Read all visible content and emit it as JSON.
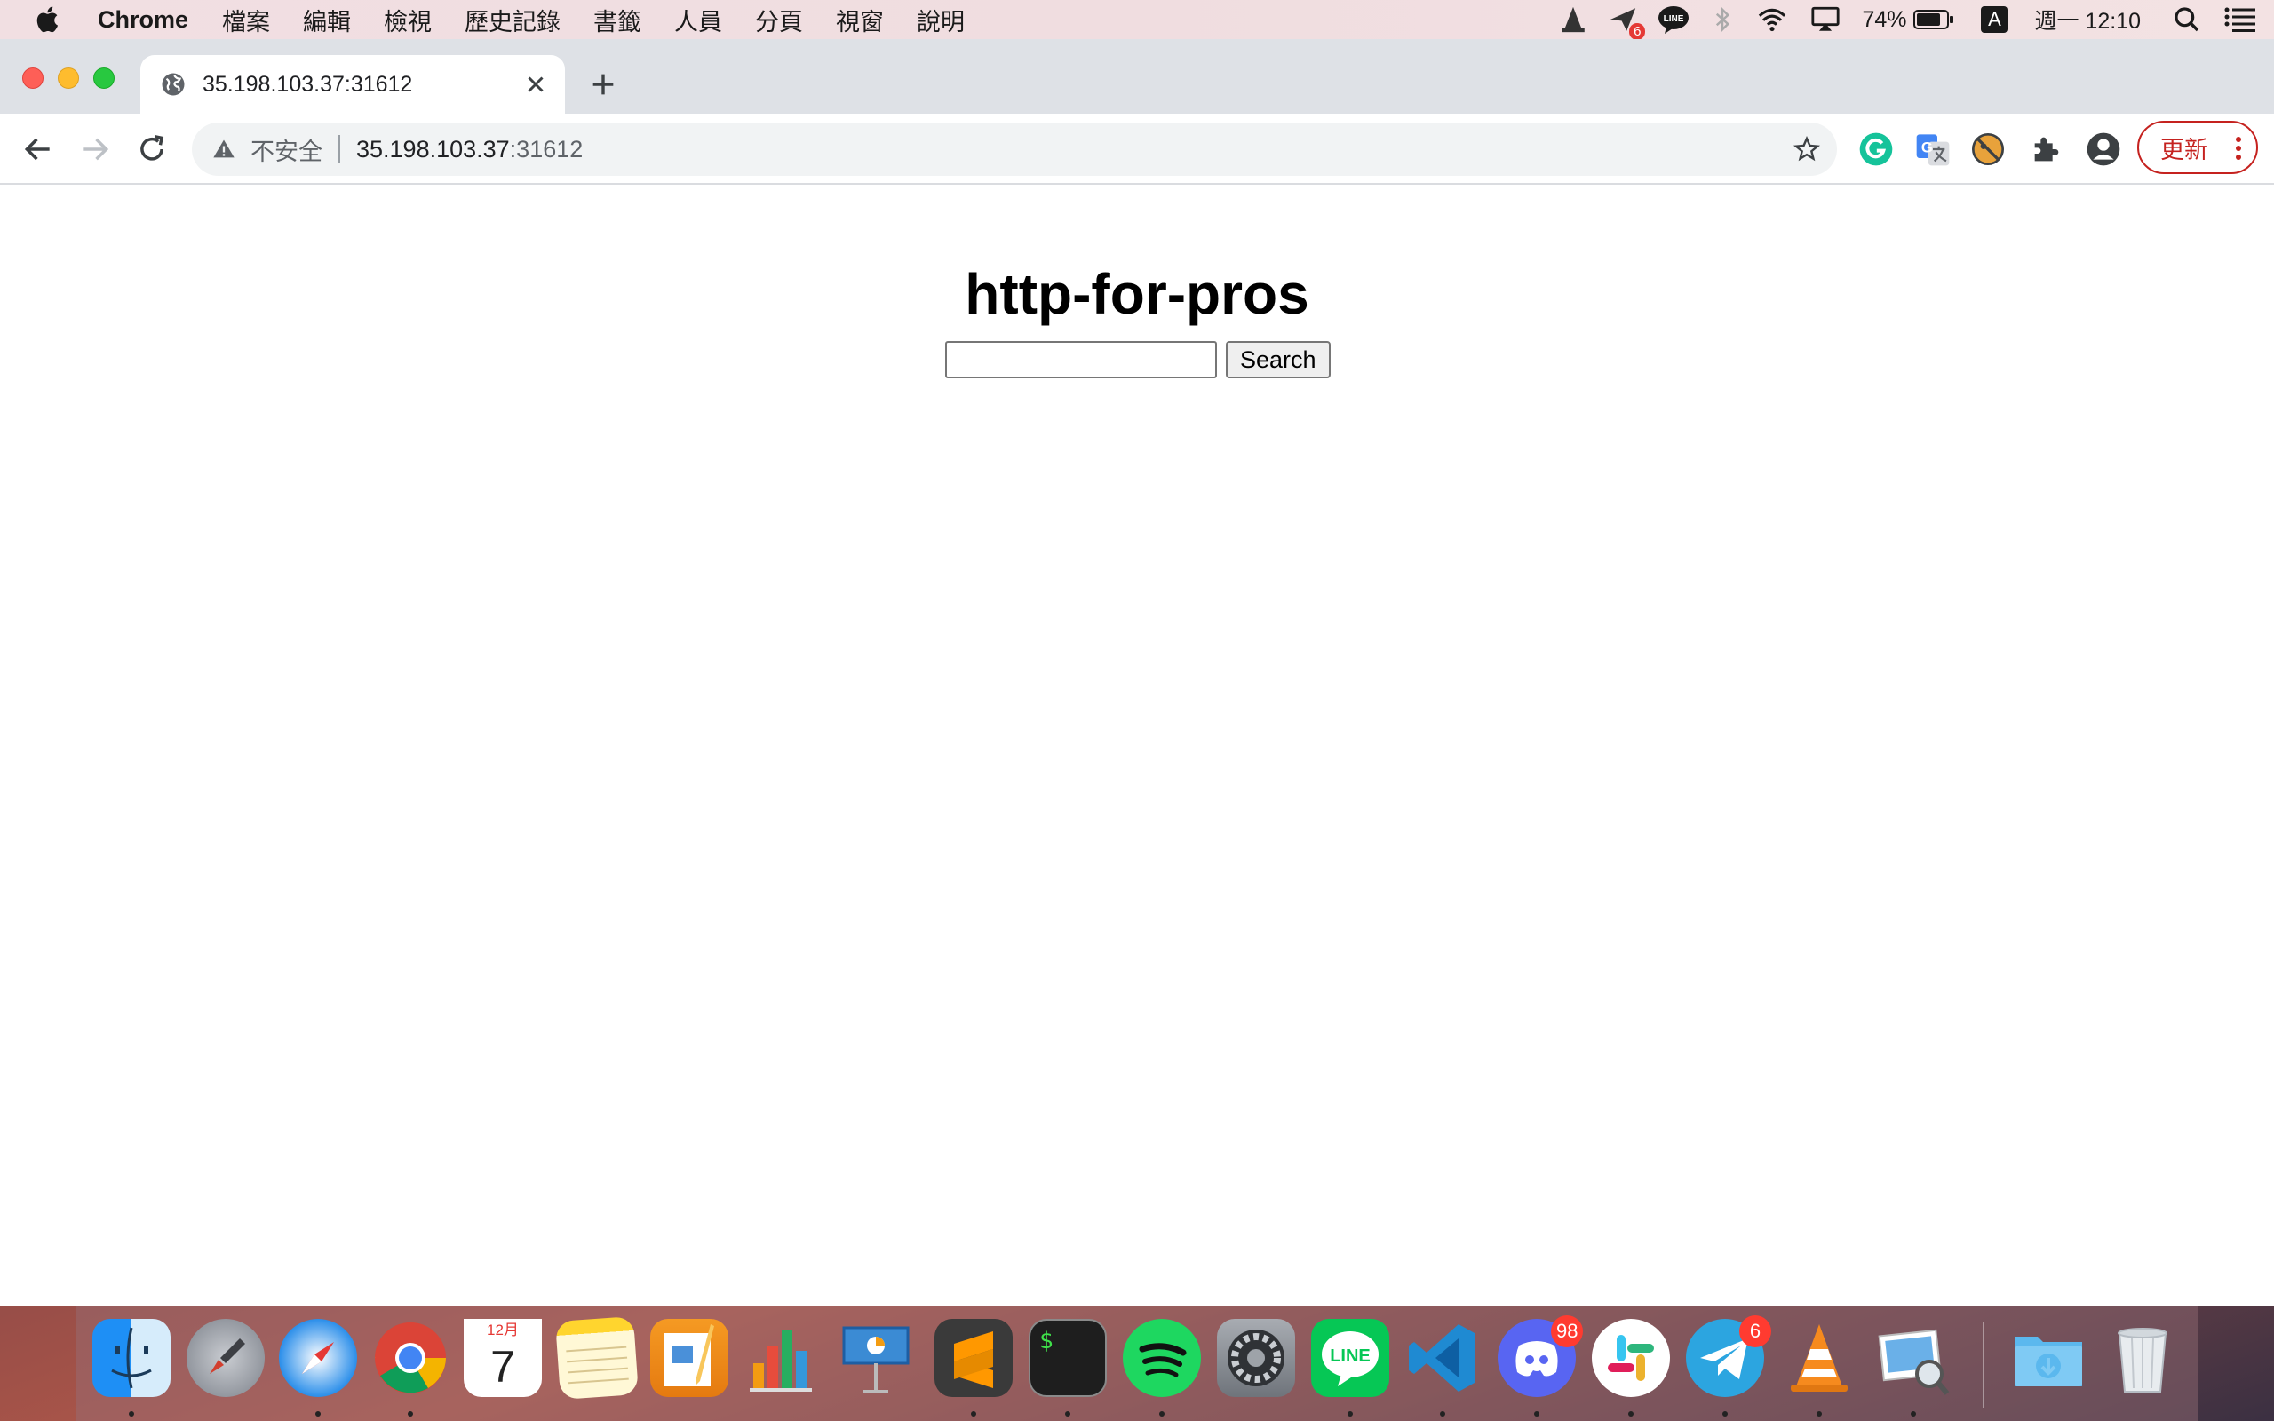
{
  "menubar": {
    "app_name": "Chrome",
    "items": [
      "檔案",
      "編輯",
      "檢視",
      "歷史記錄",
      "書籤",
      "人員",
      "分頁",
      "視窗",
      "說明"
    ],
    "battery": "74%",
    "input_method": "A",
    "clock": "週一 12:10",
    "notification_count": "6",
    "line_label": "LINE"
  },
  "browser": {
    "tab_title": "35.198.103.37:31612",
    "security_label": "不安全",
    "url_host": "35.198.103.37",
    "url_port": ":31612",
    "update_label": "更新"
  },
  "page": {
    "title": "http-for-pros",
    "search_value": "",
    "search_button": "Search"
  },
  "dock": {
    "calendar_month": "12月",
    "calendar_day": "7",
    "discord_badge": "98",
    "telegram_badge": "6",
    "line_label": "LINE",
    "terminal_prompt": "$"
  },
  "colors": {
    "update_red": "#c5221f",
    "tab_strip": "#dee1e6",
    "omnibox_bg": "#f1f3f4",
    "badge_red": "#ff3b30"
  }
}
